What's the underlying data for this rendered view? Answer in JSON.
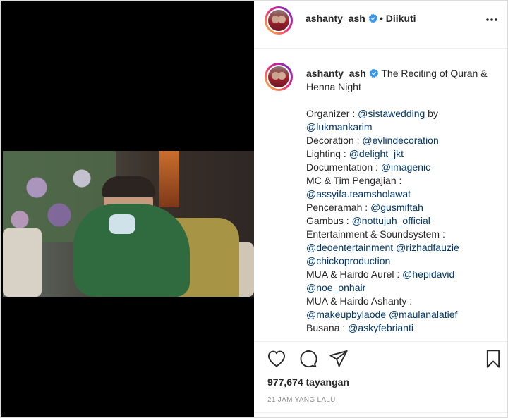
{
  "post": {
    "username": "ashanty_ash",
    "follow_status": "• Diikuti",
    "caption_title": "The Reciting of Quran & Henna Night",
    "caption_lines": [
      [
        {
          "t": "Organizer : ",
          "link": false
        },
        {
          "t": "@sistawedding",
          "link": true
        },
        {
          "t": " by",
          "link": false
        }
      ],
      [
        {
          "t": "@lukmankarim",
          "link": true
        }
      ],
      [
        {
          "t": "Decoration : ",
          "link": false
        },
        {
          "t": "@evlindecoration",
          "link": true
        }
      ],
      [
        {
          "t": "Lighting : ",
          "link": false
        },
        {
          "t": "@delight_jkt",
          "link": true
        }
      ],
      [
        {
          "t": "Documentation : ",
          "link": false
        },
        {
          "t": "@imagenic",
          "link": true
        }
      ],
      [
        {
          "t": "MC & Tim Pengajian :",
          "link": false
        }
      ],
      [
        {
          "t": "@assyifa.teamsholawat",
          "link": true
        }
      ],
      [
        {
          "t": "Penceramah : ",
          "link": false
        },
        {
          "t": "@gusmiftah",
          "link": true
        }
      ],
      [
        {
          "t": "Gambus : ",
          "link": false
        },
        {
          "t": "@nottujuh_official",
          "link": true
        }
      ],
      [
        {
          "t": "Entertainment & Soundsystem :",
          "link": false
        }
      ],
      [
        {
          "t": "@deoentertainment",
          "link": true
        },
        {
          "t": " ",
          "link": false
        },
        {
          "t": "@rizhadfauzie",
          "link": true
        }
      ],
      [
        {
          "t": "@chickoproduction",
          "link": true
        }
      ],
      [
        {
          "t": "MUA & Hairdo Aurel : ",
          "link": false
        },
        {
          "t": "@hepidavid",
          "link": true
        }
      ],
      [
        {
          "t": "@noe_onhair",
          "link": true
        }
      ],
      [
        {
          "t": "MUA & Hairdo Ashanty :",
          "link": false
        }
      ],
      [
        {
          "t": "@makeupbylaode",
          "link": true
        },
        {
          "t": " ",
          "link": false
        },
        {
          "t": "@maulanalatief",
          "link": true
        }
      ],
      [
        {
          "t": "Busana : ",
          "link": false
        },
        {
          "t": "@askyfebrianti",
          "link": true
        }
      ]
    ],
    "views": "977,674 tayangan",
    "time_ago": "21 JAM YANG LALU"
  },
  "icons": {
    "verified": "verified-badge-icon",
    "more": "more-options-icon",
    "like": "heart-icon",
    "comment": "comment-icon",
    "share": "send-icon",
    "save": "bookmark-icon"
  },
  "colors": {
    "link": "#00376b",
    "verified": "#3897f0",
    "muted": "#8e8e8e"
  }
}
